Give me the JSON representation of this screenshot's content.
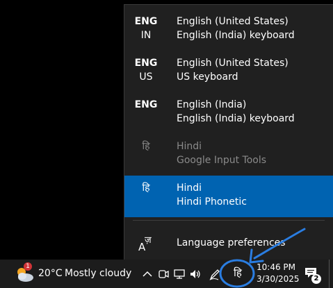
{
  "flyout": {
    "items": [
      {
        "code_line1": "ENG",
        "code_line2": "IN",
        "name": "English (United States)",
        "keyboard": "English (India) keyboard",
        "selected": false,
        "dimmed": false
      },
      {
        "code_line1": "ENG",
        "code_line2": "US",
        "name": "English (United States)",
        "keyboard": "US keyboard",
        "selected": false,
        "dimmed": false
      },
      {
        "code_line1": "ENG",
        "code_line2": "",
        "name": "English (India)",
        "keyboard": "English (India) keyboard",
        "selected": false,
        "dimmed": false
      },
      {
        "code_line1": "हि",
        "code_line2": "",
        "name": "Hindi",
        "keyboard": "Google Input Tools",
        "selected": false,
        "dimmed": true
      },
      {
        "code_line1": "हि",
        "code_line2": "",
        "name": "Hindi",
        "keyboard": "Hindi Phonetic",
        "selected": true,
        "dimmed": false
      }
    ],
    "preferences_label": "Language preferences",
    "preferences_icon": "language-settings-icon"
  },
  "taskbar": {
    "weather": {
      "icon": "partly-cloudy-icon",
      "badge": "1",
      "temperature": "20°C",
      "condition": "Mostly cloudy"
    },
    "tray_icons": [
      "chevron-up-icon",
      "meet-now-icon",
      "network-icon",
      "volume-icon",
      "pen-icon"
    ],
    "ime_indicator": "हि",
    "clock": {
      "time": "10:46 PM",
      "date": "3/30/2025"
    },
    "notifications": {
      "icon": "action-center-icon",
      "count": "2"
    }
  },
  "colors": {
    "flyout_bg": "#202020",
    "selected_bg": "#0063b1",
    "taskbar_bg": "#1c1c1c",
    "annotation": "#2a7de1"
  }
}
